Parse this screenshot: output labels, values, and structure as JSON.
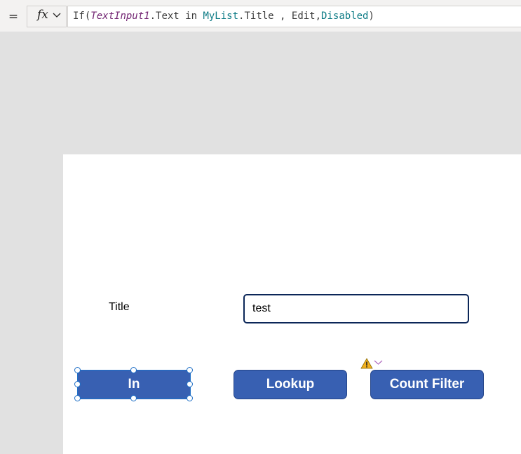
{
  "formula_bar": {
    "equals_label": "=",
    "fx_label": "fx",
    "tokens": {
      "t1": "If(",
      "t2": "TextInput1",
      "t3": ".Text in ",
      "t4": "MyList",
      "t5": ".Title , Edit,",
      "t6": "Disabled",
      "t7": ")"
    }
  },
  "canvas": {
    "title_label": "Title",
    "text_input_value": "test",
    "buttons": {
      "in": "In",
      "lookup": "Lookup",
      "count_filter": "Count Filter"
    }
  },
  "colors": {
    "button_fill": "#3860b2",
    "selection": "#1f6fc6",
    "warning": "#f2b01e"
  },
  "icons": {
    "formula": "fx-icon",
    "warning": "warning-icon",
    "chevron": "chevron-down-icon"
  }
}
